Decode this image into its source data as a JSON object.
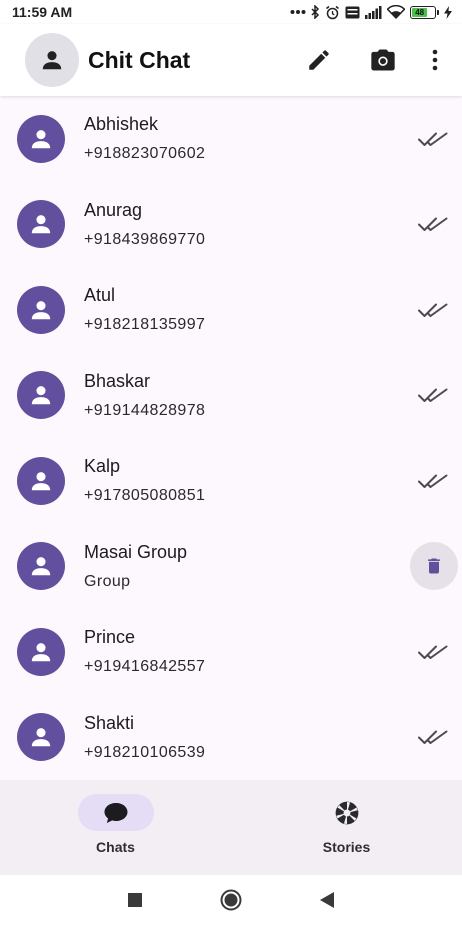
{
  "status_bar": {
    "time": "11:59 AM",
    "battery_level": "48",
    "icons": [
      "more-dots-icon",
      "bluetooth-icon",
      "alarm-icon",
      "volte-icon",
      "signal-icon",
      "wifi-icon",
      "battery-icon",
      "charging-icon"
    ]
  },
  "app_bar": {
    "title": "Chit Chat",
    "actions": [
      "edit-icon",
      "camera-icon",
      "more-vert-icon"
    ]
  },
  "contacts": [
    {
      "name": "Abhishek",
      "subtitle": "+918823070602",
      "trailing": "double-check-icon"
    },
    {
      "name": "Anurag",
      "subtitle": "+918439869770",
      "trailing": "double-check-icon"
    },
    {
      "name": "Atul",
      "subtitle": "+918218135997",
      "trailing": "double-check-icon"
    },
    {
      "name": "Bhaskar",
      "subtitle": "+919144828978",
      "trailing": "double-check-icon"
    },
    {
      "name": "Kalp",
      "subtitle": "+917805080851",
      "trailing": "double-check-icon"
    },
    {
      "name": "Masai Group",
      "subtitle": "Group",
      "trailing": "delete-icon"
    },
    {
      "name": "Prince",
      "subtitle": "+919416842557",
      "trailing": "double-check-icon"
    },
    {
      "name": "Shakti",
      "subtitle": "+918210106539",
      "trailing": "double-check-icon"
    }
  ],
  "bottom_nav": {
    "items": [
      {
        "label": "Chats",
        "icon": "chat-bubble-icon",
        "active": true
      },
      {
        "label": "Stories",
        "icon": "shutter-icon",
        "active": false
      }
    ]
  },
  "colors": {
    "accent": "#62509e",
    "nav_active_pill": "#e5dcf5",
    "nav_background": "#f2eef4",
    "list_background": "#fdf8fd",
    "battery": "#4cc24c"
  }
}
